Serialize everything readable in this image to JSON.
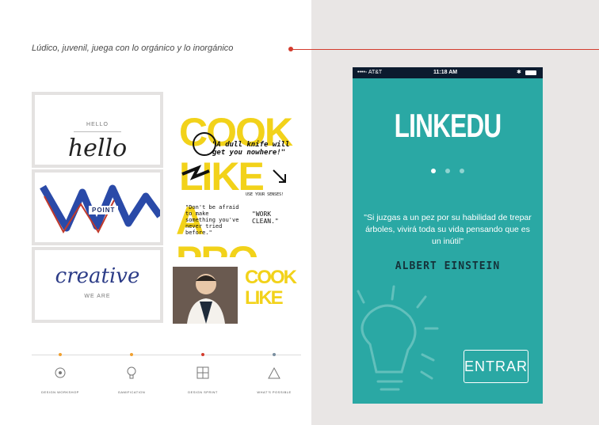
{
  "caption": "Lúdico, juvenil, juega con lo orgánico y lo inorgánico",
  "colors": {
    "accent_line": "#d33c2e",
    "phone_bg": "#2aa8a4",
    "poster_yellow": "#f2d21a",
    "status_bar": "#0c1b2e"
  },
  "moodboard": {
    "tile1": {
      "small": "HELLO",
      "script": "hello"
    },
    "tile2": {
      "badge": "POINT"
    },
    "tile3": {
      "script": "creative",
      "small": "WE ARE"
    },
    "poster": {
      "big_words": [
        "COOK",
        "LIKE",
        "A PRO."
      ],
      "notes": [
        "\"A dull knife will get you nowhere!\"",
        "\"Don't be afraid to make something you've never tried before.\"",
        "\"WORK CLEAN.\"",
        "USE YOUR SENSES!"
      ]
    }
  },
  "steps": [
    {
      "label": "DESIGN WORKSHOP",
      "color": "#f0a030",
      "icon": "gear-icon"
    },
    {
      "label": "GAMIFICATION",
      "color": "#f0a030",
      "icon": "lightbulb-icon"
    },
    {
      "label": "DESIGN SPRINT",
      "color": "#d33c2e",
      "icon": "grid-icon"
    },
    {
      "label": "WHAT'S POSSIBLE",
      "color": "#7a8fa0",
      "icon": "building-icon"
    }
  ],
  "phone": {
    "status": {
      "carrier": "••••◦ AT&T",
      "time": "11:18 AM",
      "bt": "✱"
    },
    "brand": "LINKEDU",
    "pager": {
      "count": 3,
      "active": 0
    },
    "quote": "\"Si juzgas a un pez por su habilidad de trepar árboles, vivirá toda su vida pensando que es un inútil\"",
    "author": "ALBERT EINSTEIN",
    "enter_label": "ENTRAR"
  }
}
